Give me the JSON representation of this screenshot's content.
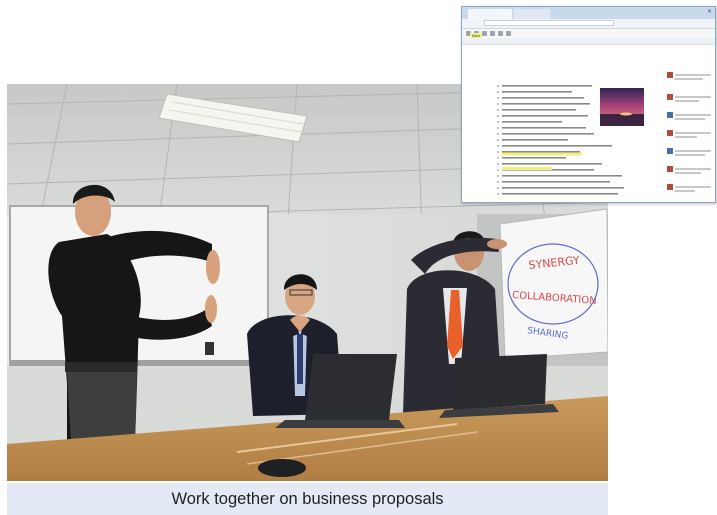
{
  "caption": "Work together on business proposals",
  "colors": {
    "caption_bg": "#e3eaf5",
    "inset_border": "#8aa6c4",
    "highlight": "#f4f28c"
  },
  "whiteboard_words": [
    "SYNERGY",
    "COLLABORATION",
    "SHARING"
  ],
  "inset": {
    "tabs": [
      "",
      ""
    ],
    "url": "",
    "doc_title": "Intro"
  }
}
